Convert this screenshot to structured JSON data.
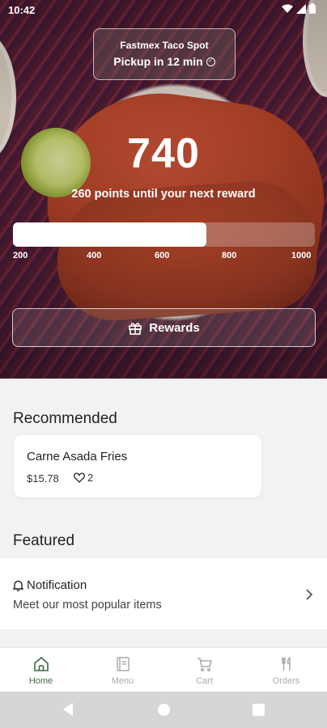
{
  "status": {
    "time": "10:42"
  },
  "store": {
    "name": "Fastmex Taco Spot",
    "pickup": "Pickup in 12 min",
    "pickup_icon": "clock-check-icon"
  },
  "rewards": {
    "points": "740",
    "subtitle": "260 points until your next reward",
    "progress_fraction": 0.64,
    "ticks": [
      "200",
      "400",
      "600",
      "800",
      "1000"
    ],
    "button_label": "Rewards",
    "button_icon": "gift-icon"
  },
  "recommended": {
    "title": "Recommended",
    "items": [
      {
        "name": "Carne Asada Fries",
        "price": "$15.78",
        "likes": "2"
      }
    ]
  },
  "featured": {
    "title": "Featured",
    "items": [
      {
        "title": "Notification",
        "description": "Meet our most popular items"
      }
    ]
  },
  "bottom_nav": [
    {
      "label": "Home",
      "icon": "home-icon",
      "active": true
    },
    {
      "label": "Menu",
      "icon": "menu-book-icon",
      "active": false
    },
    {
      "label": "Cart",
      "icon": "cart-icon",
      "active": false
    },
    {
      "label": "Orders",
      "icon": "utensils-icon",
      "active": false
    }
  ],
  "colors": {
    "accent": "#3d6b3f",
    "inactive_nav": "#aaaaaa",
    "system_nav": "#d6d6d6"
  }
}
